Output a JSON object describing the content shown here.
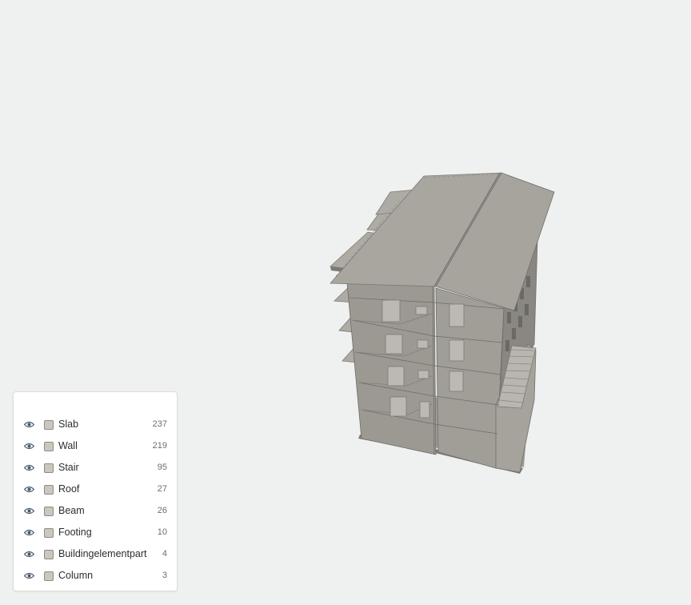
{
  "app": {
    "viewer": "3D model viewport"
  },
  "categories_panel": {
    "header": "",
    "items": [
      {
        "label": "Slab",
        "count": "237",
        "icon": "eye-icon"
      },
      {
        "label": "Wall",
        "count": "219",
        "icon": "eye-icon"
      },
      {
        "label": "Stair",
        "count": "95",
        "icon": "eye-icon"
      },
      {
        "label": "Roof",
        "count": "27",
        "icon": "eye-icon"
      },
      {
        "label": "Beam",
        "count": "26",
        "icon": "eye-icon"
      },
      {
        "label": "Footing",
        "count": "10",
        "icon": "eye-icon"
      },
      {
        "label": "Buildingelementpart",
        "count": "4",
        "icon": "eye-icon"
      },
      {
        "label": "Column",
        "count": "3",
        "icon": "eye-icon"
      }
    ]
  },
  "colors": {
    "background": "#eff1f0",
    "building": "#a8a59f",
    "swatch": "#cbc7bf",
    "eye": "#4a5a6a"
  }
}
